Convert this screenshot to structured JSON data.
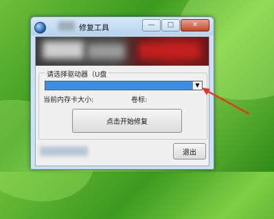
{
  "window": {
    "title": "修复工具",
    "icon": "app-globe-icon",
    "controls": {
      "minimize": "—",
      "maximize": "□",
      "close": "✕"
    }
  },
  "drive_group": {
    "label": "请选择驱动器（U盘",
    "dropdown": {
      "selected": "",
      "arrow": "▼"
    },
    "card_size_label": "当前内存卡大小:",
    "volume_label": "卷标:"
  },
  "buttons": {
    "start_repair": "点击开始修复",
    "exit": "退出"
  },
  "colors": {
    "dropdown_highlight": "#3a8ee6",
    "annotation_arrow": "#e2362b",
    "desktop_green": "#4ea82a"
  }
}
